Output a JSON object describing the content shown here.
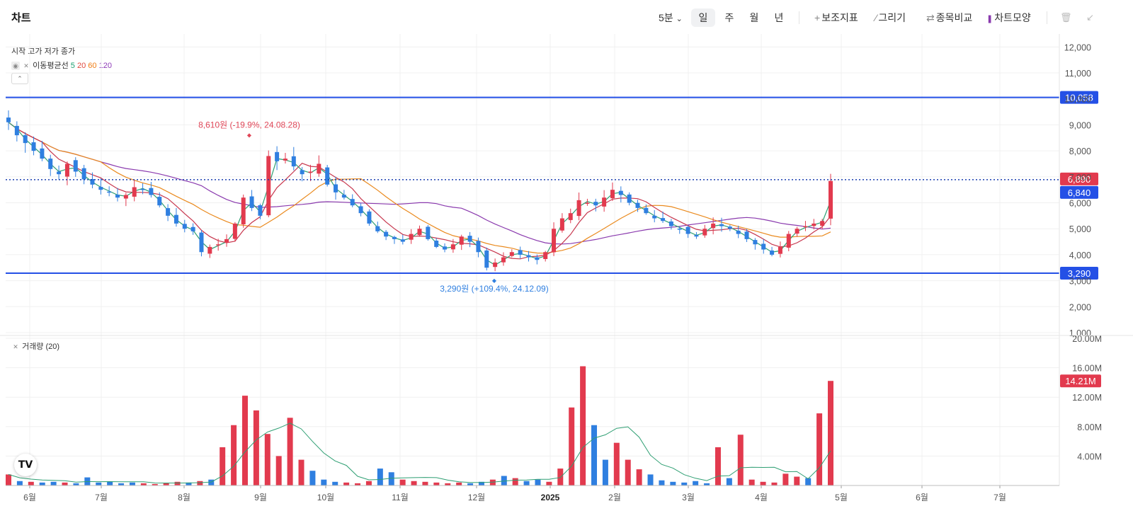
{
  "header": {
    "title": "차트",
    "interval": "5분",
    "periods": [
      "일",
      "주",
      "월",
      "년"
    ],
    "selected_period": "일",
    "tools": [
      "보조지표",
      "그리기",
      "종목비교",
      "차트모양"
    ]
  },
  "legend": {
    "ohlc_label": "시작 고가 저가 종가",
    "ma_label": "이동평균선",
    "ma_periods": [
      "5",
      "20",
      "60",
      "120"
    ],
    "ma_colors": [
      "#1a9e6e",
      "#e0483e",
      "#f07c14",
      "#8e3ab8"
    ],
    "volume_label": "거래량 (20)"
  },
  "colors": {
    "up": "#e23a4e",
    "down": "#2f7fe0",
    "line_blue": "#2450e6",
    "ma5": "#2f9f73",
    "ma20": "#c7364d",
    "ma60": "#ea8a1e",
    "ma120": "#8a3aae",
    "vol_ma": "#2f9f73"
  },
  "chart_data": {
    "type": "candlestick",
    "x_ticks": [
      "6월",
      "7월",
      "8월",
      "9월",
      "10월",
      "11월",
      "12월",
      "2025",
      "2월",
      "3월",
      "4월",
      "5월",
      "6월",
      "7월"
    ],
    "price_axis": {
      "ylim": [
        1000,
        12500
      ],
      "ticks": [
        "12,000",
        "11,000",
        "10,000",
        "9,000",
        "8,000",
        "7,000",
        "6,000",
        "5,000",
        "4,000",
        "3,000",
        "2,000",
        "1,000"
      ]
    },
    "volume_axis": {
      "ylim": [
        0,
        20000000
      ],
      "ticks": [
        "20.00M",
        "16.00M",
        "12.00M",
        "8.00M",
        "4.00M"
      ]
    },
    "horizontal_lines": [
      {
        "value": 10058,
        "label": "10,058"
      },
      {
        "value": 3290,
        "label": "3,290"
      }
    ],
    "price_badges": [
      {
        "value": 6890,
        "label": "6,890"
      },
      {
        "value": 6840,
        "label": "6,840"
      }
    ],
    "volume_badge": "14.21M",
    "annotations": [
      {
        "text": "8,610원 (-19.9%, 24.08.28)",
        "value": 8610,
        "date": "24.08.28"
      },
      {
        "text": "3,290원 (+109.4%, 24.12.09)",
        "value": 3290,
        "date": "24.12.09"
      }
    ],
    "close_series_sampled": [
      9100,
      8600,
      8300,
      8000,
      7700,
      7300,
      7100,
      7500,
      7200,
      6900,
      6700,
      6500,
      6400,
      6200,
      6300,
      6600,
      6500,
      6300,
      5900,
      5500,
      5200,
      5000,
      4900,
      4100,
      4300,
      4400,
      4600,
      5200,
      6200,
      5800,
      5500,
      7800,
      7600,
      7700,
      7400,
      7100,
      7200,
      7500,
      6700,
      6400,
      6200,
      5900,
      5600,
      5200,
      4900,
      4700,
      4600,
      4500,
      4800,
      5000,
      4600,
      4300,
      4200,
      4400,
      4700,
      4500,
      4100,
      3500,
      3700,
      3900,
      4100,
      4000,
      3900,
      3800,
      4100,
      5000,
      5400,
      5600,
      6100,
      6000,
      5900,
      6200,
      6500,
      6300,
      6000,
      5800,
      5600,
      5400,
      5300,
      5100,
      5000,
      4800,
      4700,
      5000,
      5200,
      5100,
      5000,
      4800,
      4600,
      4400,
      4200,
      4000,
      4300,
      4800,
      5000,
      5100,
      5200,
      5300,
      6840
    ],
    "volume_series_sampled_M": [
      1.5,
      0.6,
      0.5,
      0.4,
      0.5,
      0.4,
      0.3,
      1.1,
      0.4,
      0.5,
      0.3,
      0.4,
      0.3,
      0.2,
      0.3,
      0.5,
      0.4,
      0.6,
      0.8,
      5.2,
      8.2,
      12.2,
      10.2,
      7.0,
      4.0,
      9.2,
      3.5,
      2.0,
      0.8,
      0.5,
      0.4,
      0.3,
      0.6,
      2.3,
      1.8,
      0.8,
      0.6,
      0.5,
      0.4,
      0.3,
      0.4,
      0.3,
      0.5,
      0.8,
      1.3,
      1.0,
      0.6,
      0.8,
      0.5,
      2.3,
      10.6,
      16.2,
      8.2,
      3.5,
      5.8,
      3.5,
      2.2,
      1.5,
      0.7,
      0.5,
      0.4,
      0.6,
      0.3,
      5.2,
      1.0,
      6.9,
      0.8,
      0.5,
      0.4,
      1.6,
      1.2,
      1.0,
      9.8,
      14.21
    ]
  }
}
